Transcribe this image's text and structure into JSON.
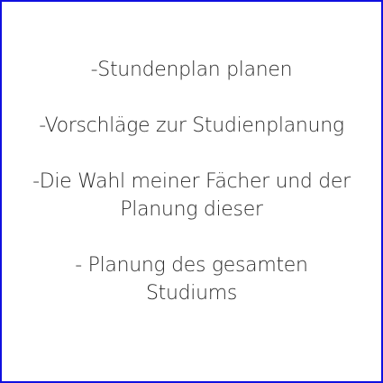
{
  "items": [
    {
      "lines": [
        "-Stundenplan planen"
      ]
    },
    {
      "lines": [
        "-Vorschläge zur Studienplanung"
      ]
    },
    {
      "lines": [
        "-Die Wahl meiner Fächer und der",
        "Planung dieser"
      ]
    },
    {
      "lines": [
        "- Planung des gesamten",
        "Studiums"
      ]
    }
  ],
  "colors": {
    "border": "#1010e0",
    "text": "#2b2b2b",
    "background": "#ffffff"
  }
}
